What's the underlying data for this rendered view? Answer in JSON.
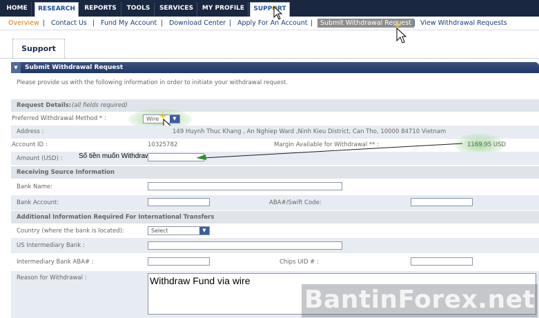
{
  "nav": {
    "tabs": [
      {
        "label": "HOME"
      },
      {
        "label": "RESEARCH"
      },
      {
        "label": "REPORTS"
      },
      {
        "label": "TOOLS"
      },
      {
        "label": "SERVICES"
      },
      {
        "label": "MY PROFILE"
      },
      {
        "label": "SUPPORT"
      }
    ]
  },
  "subnav": {
    "items": [
      {
        "label": "Overview"
      },
      {
        "label": "Contact Us"
      },
      {
        "label": "Fund My Account"
      },
      {
        "label": "Download Center"
      },
      {
        "label": "Apply For An Account"
      },
      {
        "label": "Submit Withdrawal Request"
      },
      {
        "label": "View Withdrawal Requests"
      }
    ],
    "separator": "|"
  },
  "support_label": "Support",
  "section_title": "Submit Withdrawal Request",
  "intro_text": "Please provide us with the following information in order to initiate your withdrawal request.",
  "request_details": {
    "title": "Request Details:",
    "note": "(all fields required)",
    "method_label": "Preferred Withdrawal Method * :",
    "method_value": "Wire",
    "address_label": "Address :",
    "address_value": "149 Huynh Thuc Khang , An Nghiep Ward ,Ninh Kieu District, Can Tho, 10000 84710 Vietnam",
    "account_label": "Account ID :",
    "account_value": "10325782",
    "margin_label": "Margin Available for Withdrawal ** :",
    "margin_value": "1169.95 USD",
    "amount_label": "Amount (USD) :",
    "amount_annotation": "Số tiền muốn Withdraw"
  },
  "receiving": {
    "title": "Receiving Source Information",
    "bank_name_label": "Bank Name:",
    "bank_account_label": "Bank Account:",
    "aba_swift_label": "ABA#/Swift Code:"
  },
  "international": {
    "title": "Additional Information Required For International Transfers",
    "country_label": "Country (where the bank is located):",
    "country_value": "Select",
    "us_bank_label": "US Intermediary Bank :",
    "int_aba_label": "Intermediary Bank ABA# :",
    "chips_label": "Chips UID # :",
    "reason_label": "Reason for Withdrawal :",
    "reason_value": "Withdraw Fund via wire"
  },
  "watermark": "BantinForex.net",
  "colors": {
    "nav_bg": "#1a2740",
    "section_header": "#1f3566",
    "band": "#e7ebf2",
    "accent_orange": "#e07a10",
    "link_blue": "#1a3a80",
    "highlight_green": "#a8d8a0"
  }
}
